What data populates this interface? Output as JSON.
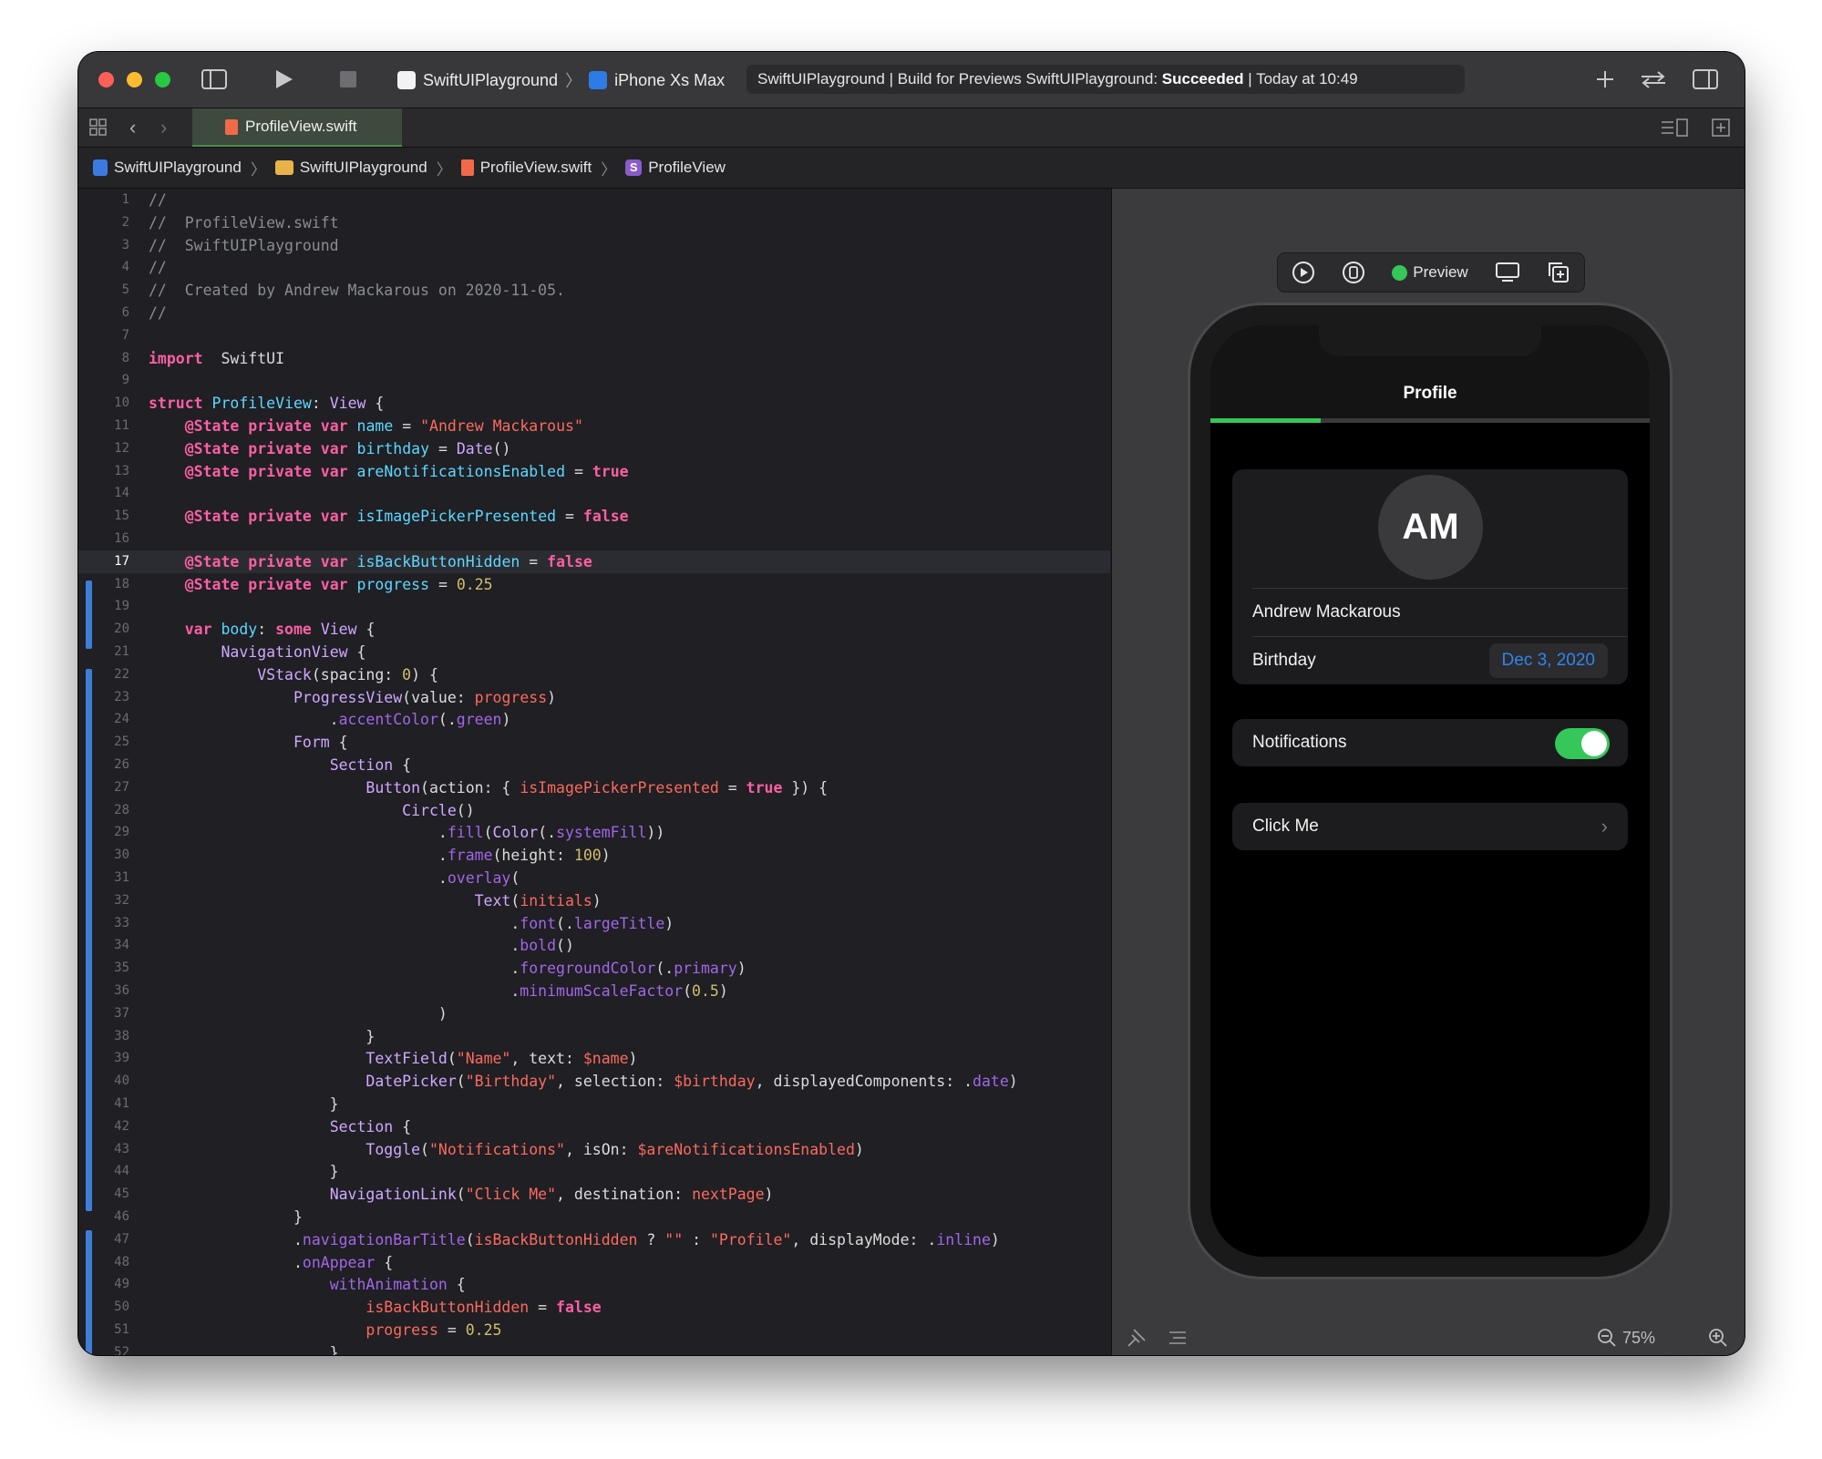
{
  "window": {
    "scheme": {
      "target": "SwiftUIPlayground",
      "device": "iPhone Xs Max"
    },
    "status": {
      "prefix": "SwiftUIPlayground | Build for Previews SwiftUIPlayground: ",
      "result": "Succeeded",
      "suffix": " | Today at 10:49"
    },
    "icons": {
      "sidebar": "sidebar-icon",
      "run": "play-icon",
      "stop": "stop-icon",
      "add": "plus-icon",
      "swap": "swap-arrows-icon",
      "inspector": "inspector-icon"
    }
  },
  "tabs": [
    {
      "label": "ProfileView.swift",
      "active": true
    }
  ],
  "breadcrumb": [
    "SwiftUIPlayground",
    "SwiftUIPlayground",
    "ProfileView.swift",
    "ProfileView"
  ],
  "editor": {
    "current_line": 17,
    "lines": [
      [
        [
          "cm",
          "//"
        ]
      ],
      [
        [
          "cm",
          "//  ProfileView.swift"
        ]
      ],
      [
        [
          "cm",
          "//  SwiftUIPlayground"
        ]
      ],
      [
        [
          "cm",
          "//"
        ]
      ],
      [
        [
          "cm",
          "//  Created by Andrew Mackarous on 2020-11-05."
        ]
      ],
      [
        [
          "cm",
          "//"
        ]
      ],
      [],
      [
        [
          "kw",
          "import"
        ],
        [
          "",
          "  SwiftUI"
        ]
      ],
      [],
      [
        [
          "kw",
          "struct"
        ],
        [
          "",
          " "
        ],
        [
          "dec",
          "ProfileView"
        ],
        [
          "",
          ": "
        ],
        [
          "ty",
          "View"
        ],
        [
          "",
          " {"
        ]
      ],
      [
        [
          "",
          "    "
        ],
        [
          "kw",
          "@State"
        ],
        [
          "",
          " "
        ],
        [
          "kw",
          "private"
        ],
        [
          "",
          " "
        ],
        [
          "kw",
          "var"
        ],
        [
          "",
          " "
        ],
        [
          "dec",
          "name"
        ],
        [
          "",
          " = "
        ],
        [
          "str",
          "\"Andrew Mackarous\""
        ]
      ],
      [
        [
          "",
          "    "
        ],
        [
          "kw",
          "@State"
        ],
        [
          "",
          " "
        ],
        [
          "kw",
          "private"
        ],
        [
          "",
          " "
        ],
        [
          "kw",
          "var"
        ],
        [
          "",
          " "
        ],
        [
          "dec",
          "birthday"
        ],
        [
          "",
          " = "
        ],
        [
          "ty",
          "Date"
        ],
        [
          "",
          "()"
        ]
      ],
      [
        [
          "",
          "    "
        ],
        [
          "kw",
          "@State"
        ],
        [
          "",
          " "
        ],
        [
          "kw",
          "private"
        ],
        [
          "",
          " "
        ],
        [
          "kw",
          "var"
        ],
        [
          "",
          " "
        ],
        [
          "dec",
          "areNotificationsEnabled"
        ],
        [
          "",
          " = "
        ],
        [
          "kw",
          "true"
        ]
      ],
      [],
      [
        [
          "",
          "    "
        ],
        [
          "kw",
          "@State"
        ],
        [
          "",
          " "
        ],
        [
          "kw",
          "private"
        ],
        [
          "",
          " "
        ],
        [
          "kw",
          "var"
        ],
        [
          "",
          " "
        ],
        [
          "dec",
          "isImagePickerPresented"
        ],
        [
          "",
          " = "
        ],
        [
          "kw",
          "false"
        ]
      ],
      [],
      [
        [
          "",
          "    "
        ],
        [
          "kw",
          "@State"
        ],
        [
          "",
          " "
        ],
        [
          "kw",
          "private"
        ],
        [
          "",
          " "
        ],
        [
          "kw",
          "var"
        ],
        [
          "",
          " "
        ],
        [
          "dec",
          "isBackButtonHidden"
        ],
        [
          "",
          " = "
        ],
        [
          "kw",
          "false"
        ]
      ],
      [
        [
          "",
          "    "
        ],
        [
          "kw",
          "@State"
        ],
        [
          "",
          " "
        ],
        [
          "kw",
          "private"
        ],
        [
          "",
          " "
        ],
        [
          "kw",
          "var"
        ],
        [
          "",
          " "
        ],
        [
          "dec",
          "progress"
        ],
        [
          "",
          " = "
        ],
        [
          "num",
          "0.25"
        ]
      ],
      [],
      [
        [
          "",
          "    "
        ],
        [
          "kw",
          "var"
        ],
        [
          "",
          " "
        ],
        [
          "dec",
          "body"
        ],
        [
          "",
          ": "
        ],
        [
          "kw",
          "some"
        ],
        [
          "",
          " "
        ],
        [
          "ty",
          "View"
        ],
        [
          "",
          " {"
        ]
      ],
      [
        [
          "",
          "        "
        ],
        [
          "ty",
          "NavigationView"
        ],
        [
          "",
          " {"
        ]
      ],
      [
        [
          "",
          "            "
        ],
        [
          "ty",
          "VStack"
        ],
        [
          "",
          "(spacing: "
        ],
        [
          "num",
          "0"
        ],
        [
          "",
          ") {"
        ]
      ],
      [
        [
          "",
          "                "
        ],
        [
          "ty",
          "ProgressView"
        ],
        [
          "",
          "(value: "
        ],
        [
          "str",
          "progress"
        ],
        [
          "",
          ")"
        ]
      ],
      [
        [
          "",
          "                    ."
        ],
        [
          "prop",
          "accentColor"
        ],
        [
          "",
          "(."
        ],
        [
          "prop",
          "green"
        ],
        [
          "",
          ")"
        ]
      ],
      [
        [
          "",
          "                "
        ],
        [
          "ty",
          "Form"
        ],
        [
          "",
          " {"
        ]
      ],
      [
        [
          "",
          "                    "
        ],
        [
          "ty",
          "Section"
        ],
        [
          "",
          " {"
        ]
      ],
      [
        [
          "",
          "                        "
        ],
        [
          "ty",
          "Button"
        ],
        [
          "",
          "(action: { "
        ],
        [
          "str",
          "isImagePickerPresented"
        ],
        [
          "",
          " = "
        ],
        [
          "kw",
          "true"
        ],
        [
          "",
          " }) {"
        ]
      ],
      [
        [
          "",
          "                            "
        ],
        [
          "ty",
          "Circle"
        ],
        [
          "",
          "()"
        ]
      ],
      [
        [
          "",
          "                                ."
        ],
        [
          "prop",
          "fill"
        ],
        [
          "",
          "("
        ],
        [
          "ty",
          "Color"
        ],
        [
          "",
          "(."
        ],
        [
          "prop",
          "systemFill"
        ],
        [
          "",
          "))"
        ]
      ],
      [
        [
          "",
          "                                ."
        ],
        [
          "prop",
          "frame"
        ],
        [
          "",
          "(height: "
        ],
        [
          "num",
          "100"
        ],
        [
          "",
          ")"
        ]
      ],
      [
        [
          "",
          "                                ."
        ],
        [
          "prop",
          "overlay"
        ],
        [
          "",
          "("
        ]
      ],
      [
        [
          "",
          "                                    "
        ],
        [
          "ty",
          "Text"
        ],
        [
          "",
          "("
        ],
        [
          "str",
          "initials"
        ],
        [
          "",
          ")"
        ]
      ],
      [
        [
          "",
          "                                        ."
        ],
        [
          "prop",
          "font"
        ],
        [
          "",
          "(."
        ],
        [
          "prop",
          "largeTitle"
        ],
        [
          "",
          ")"
        ]
      ],
      [
        [
          "",
          "                                        ."
        ],
        [
          "prop",
          "bold"
        ],
        [
          "",
          "()"
        ]
      ],
      [
        [
          "",
          "                                        ."
        ],
        [
          "prop",
          "foregroundColor"
        ],
        [
          "",
          "(."
        ],
        [
          "prop",
          "primary"
        ],
        [
          "",
          ")"
        ]
      ],
      [
        [
          "",
          "                                        ."
        ],
        [
          "prop",
          "minimumScaleFactor"
        ],
        [
          "",
          "("
        ],
        [
          "num",
          "0.5"
        ],
        [
          "",
          ")"
        ]
      ],
      [
        [
          "",
          "                                )"
        ]
      ],
      [
        [
          "",
          "                        }"
        ]
      ],
      [
        [
          "",
          "                        "
        ],
        [
          "ty",
          "TextField"
        ],
        [
          "",
          "("
        ],
        [
          "str",
          "\"Name\""
        ],
        [
          "",
          ", text: "
        ],
        [
          "str",
          "$name"
        ],
        [
          "",
          ")"
        ]
      ],
      [
        [
          "",
          "                        "
        ],
        [
          "ty",
          "DatePicker"
        ],
        [
          "",
          "("
        ],
        [
          "str",
          "\"Birthday\""
        ],
        [
          "",
          ", selection: "
        ],
        [
          "str",
          "$birthday"
        ],
        [
          "",
          ", displayedComponents: ."
        ],
        [
          "prop",
          "date"
        ],
        [
          "",
          ")"
        ]
      ],
      [
        [
          "",
          "                    }"
        ]
      ],
      [
        [
          "",
          "                    "
        ],
        [
          "ty",
          "Section"
        ],
        [
          "",
          " {"
        ]
      ],
      [
        [
          "",
          "                        "
        ],
        [
          "ty",
          "Toggle"
        ],
        [
          "",
          "("
        ],
        [
          "str",
          "\"Notifications\""
        ],
        [
          "",
          ", isOn: "
        ],
        [
          "str",
          "$areNotificationsEnabled"
        ],
        [
          "",
          ")"
        ]
      ],
      [
        [
          "",
          "                    }"
        ]
      ],
      [
        [
          "",
          "                    "
        ],
        [
          "ty",
          "NavigationLink"
        ],
        [
          "",
          "("
        ],
        [
          "str",
          "\"Click Me\""
        ],
        [
          "",
          ", destination: "
        ],
        [
          "str",
          "nextPage"
        ],
        [
          "",
          ")"
        ]
      ],
      [
        [
          "",
          "                }"
        ]
      ],
      [
        [
          "",
          "                ."
        ],
        [
          "prop",
          "navigationBarTitle"
        ],
        [
          "",
          "("
        ],
        [
          "str",
          "isBackButtonHidden"
        ],
        [
          "",
          " ? "
        ],
        [
          "str",
          "\"\""
        ],
        [
          "",
          " : "
        ],
        [
          "str",
          "\"Profile\""
        ],
        [
          "",
          ", displayMode: ."
        ],
        [
          "prop",
          "inline"
        ],
        [
          "",
          ")"
        ]
      ],
      [
        [
          "",
          "                ."
        ],
        [
          "prop",
          "onAppear"
        ],
        [
          "",
          " {"
        ]
      ],
      [
        [
          "",
          "                    "
        ],
        [
          "prop",
          "withAnimation"
        ],
        [
          "",
          " {"
        ]
      ],
      [
        [
          "",
          "                        "
        ],
        [
          "str",
          "isBackButtonHidden"
        ],
        [
          "",
          " = "
        ],
        [
          "kw",
          "false"
        ]
      ],
      [
        [
          "",
          "                        "
        ],
        [
          "str",
          "progress"
        ],
        [
          "",
          " = "
        ],
        [
          "num",
          "0.25"
        ]
      ],
      [
        [
          "",
          "                    }"
        ]
      ]
    ]
  },
  "preview": {
    "toolbar": {
      "label": "Preview"
    },
    "screen": {
      "nav_title": "Profile",
      "progress": 0.25,
      "avatar_initials": "AM",
      "name_value": "Andrew Mackarous",
      "birthday_label": "Birthday",
      "birthday_value": "Dec 3, 2020",
      "notifications_label": "Notifications",
      "notifications_on": true,
      "link_label": "Click Me"
    },
    "zoom": "75%"
  },
  "colors": {
    "accent_green": "#35c759",
    "date_blue": "#2f84f0",
    "change_bar": "#3f7ed8"
  }
}
